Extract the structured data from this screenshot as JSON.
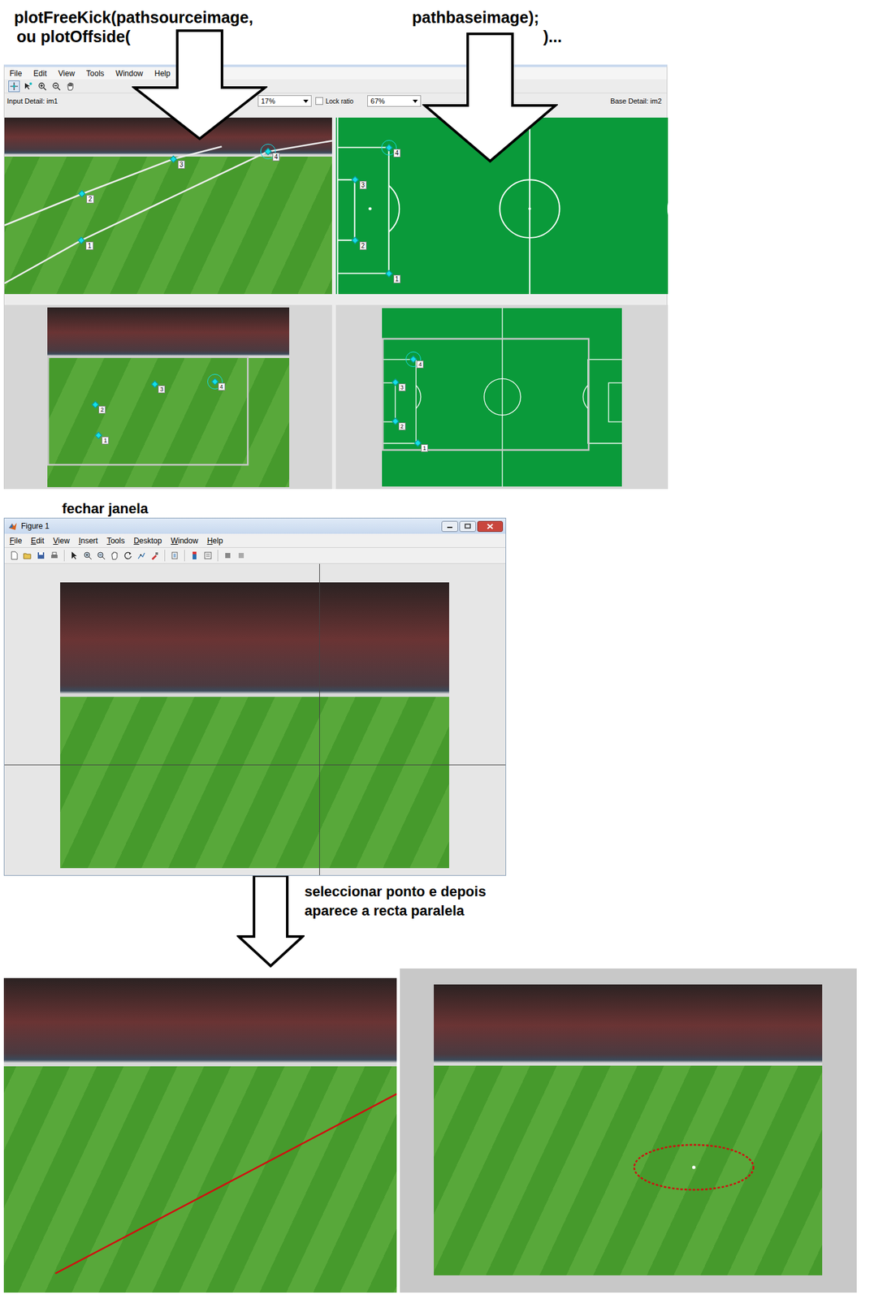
{
  "annotations": {
    "command_lines": [
      "plotFreeKick(pathsourceimage,",
      "ou plotOffside("
    ],
    "argument_lines": [
      "pathbaseimage);",
      ")..."
    ],
    "close_note": "fechar janela",
    "select_note": [
      "seleccionar ponto e depois",
      "aparece a recta paralela"
    ]
  },
  "cpselect": {
    "menu": [
      "File",
      "Edit",
      "View",
      "Tools",
      "Window",
      "Help"
    ],
    "toolbar": [
      {
        "selected": true
      },
      {
        "selected": false
      },
      {
        "selected": false
      },
      {
        "selected": false
      },
      {
        "selected": false
      }
    ],
    "input_label": "Input Detail: im1",
    "input_zoom": "17%",
    "lock_ratio": {
      "label": "Lock ratio",
      "checked": false
    },
    "base_zoom": "67%",
    "base_label": "Base Detail: im2",
    "control_points": [
      {
        "label": "1",
        "selected": false
      },
      {
        "label": "2",
        "selected": false
      },
      {
        "label": "3",
        "selected": false
      },
      {
        "label": "4",
        "selected": true
      }
    ]
  },
  "figure": {
    "title": "Figure 1",
    "menu": [
      "File",
      "Edit",
      "View",
      "Insert",
      "Tools",
      "Desktop",
      "Window",
      "Help"
    ]
  }
}
